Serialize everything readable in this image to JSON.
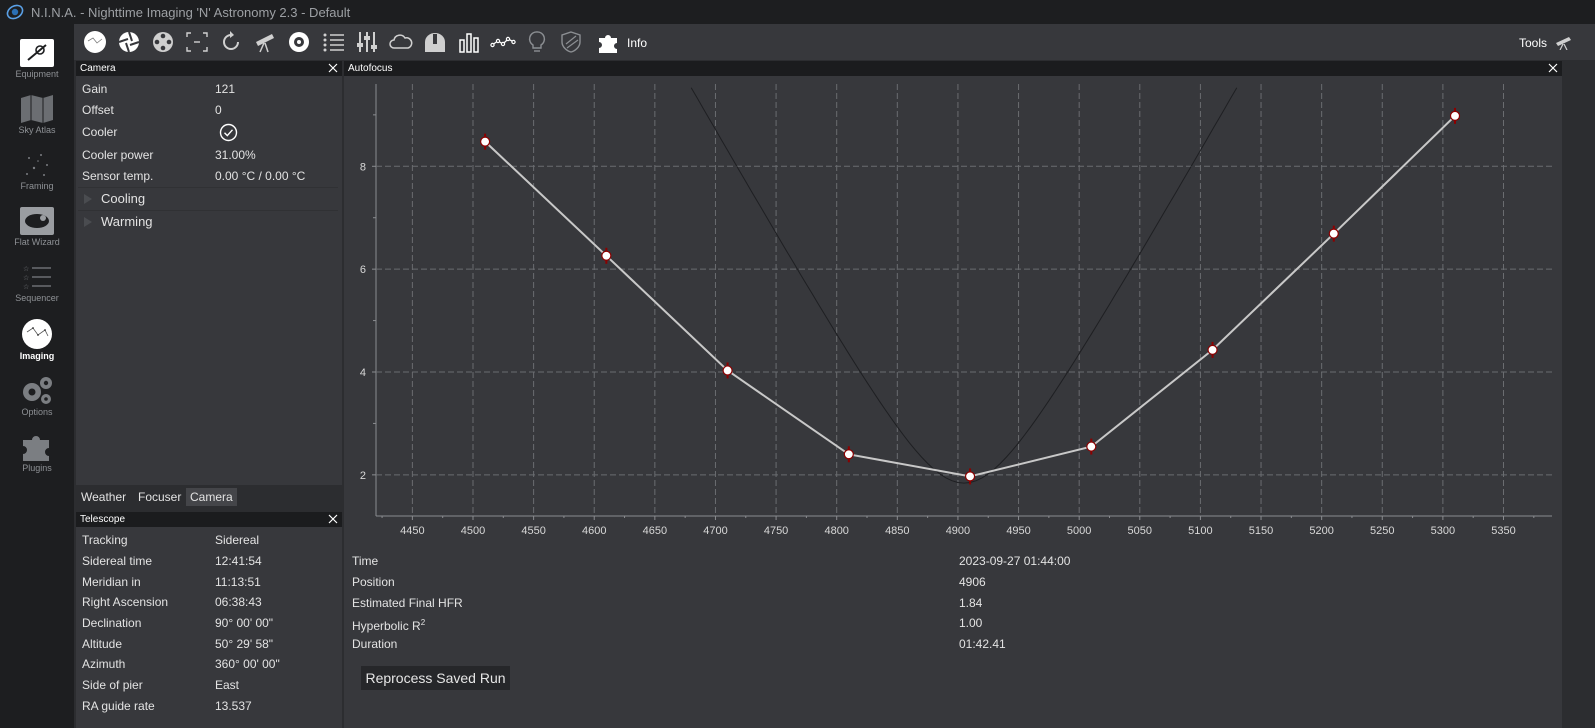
{
  "window": {
    "title": "N.I.N.A. - Nighttime Imaging 'N' Astronomy 2.3   -  Default"
  },
  "sidebar": {
    "items": [
      {
        "label": "Equipment",
        "icon": "equipment-icon"
      },
      {
        "label": "Sky Atlas",
        "icon": "sky-atlas-icon"
      },
      {
        "label": "Framing",
        "icon": "framing-icon"
      },
      {
        "label": "Flat Wizard",
        "icon": "flat-wizard-icon"
      },
      {
        "label": "Sequencer",
        "icon": "sequencer-icon"
      },
      {
        "label": "Imaging",
        "icon": "imaging-icon",
        "active": true
      },
      {
        "label": "Options",
        "icon": "options-icon"
      },
      {
        "label": "Plugins",
        "icon": "plugins-icon"
      }
    ]
  },
  "toolbar": {
    "info_label": "Info",
    "tools_label": "Tools"
  },
  "camera_panel": {
    "title": "Camera",
    "rows": [
      {
        "label": "Gain",
        "value": "121"
      },
      {
        "label": "Offset",
        "value": "0"
      },
      {
        "label": "Cooler",
        "value": ""
      },
      {
        "label": "Cooler power",
        "value": "31.00%"
      },
      {
        "label": "Sensor temp.",
        "value": "0.00 °C / 0.00 °C"
      }
    ],
    "expanders": [
      "Cooling",
      "Warming"
    ]
  },
  "tabs": {
    "items": [
      "Weather",
      "Focuser",
      "Camera"
    ],
    "active": "Camera"
  },
  "telescope_panel": {
    "title": "Telescope",
    "rows": [
      {
        "label": "Tracking",
        "value": "Sidereal"
      },
      {
        "label": "Sidereal time",
        "value": "12:41:54"
      },
      {
        "label": "Meridian in",
        "value": "11:13:51"
      },
      {
        "label": "Right Ascension",
        "value": "06:38:43"
      },
      {
        "label": "Declination",
        "value": "90° 00' 00\""
      },
      {
        "label": "Altitude",
        "value": "50° 29' 58\""
      },
      {
        "label": "Azimuth",
        "value": "360° 00' 00\""
      },
      {
        "label": "Side of pier",
        "value": "East"
      },
      {
        "label": "RA guide rate",
        "value": "13.537"
      }
    ]
  },
  "autofocus_panel": {
    "title": "Autofocus",
    "info": {
      "time_label": "Time",
      "time_value": "2023-09-27 01:44:00",
      "position_label": "Position",
      "position_value": "4906",
      "hfr_label": "Estimated Final HFR",
      "hfr_value": "1.84",
      "r2_label": "Hyperbolic R",
      "r2_sup": "2",
      "r2_value": "1.00",
      "duration_label": "Duration",
      "duration_value": "01:42.41"
    },
    "reprocess_button": "Reprocess Saved Run"
  },
  "chart_data": {
    "type": "scatter",
    "title": "",
    "xlabel": "",
    "ylabel": "",
    "xlim": [
      4420,
      5390
    ],
    "ylim": [
      1.2,
      9.6
    ],
    "x_ticks": [
      4450,
      4500,
      4550,
      4600,
      4650,
      4700,
      4750,
      4800,
      4850,
      4900,
      4950,
      5000,
      5050,
      5100,
      5150,
      5200,
      5250,
      5300,
      5350
    ],
    "y_ticks": [
      2,
      4,
      6,
      8
    ],
    "grid": true,
    "line_color": "#c8c8c8",
    "marker_color": "#8b0000",
    "series": [
      {
        "x": [
          4510,
          4610,
          4710,
          4810,
          4910,
          5010,
          5110,
          5210,
          5310
        ],
        "y": [
          8.48,
          6.26,
          4.03,
          2.4,
          1.97,
          2.55,
          4.43,
          6.69,
          8.98
        ]
      }
    ]
  }
}
